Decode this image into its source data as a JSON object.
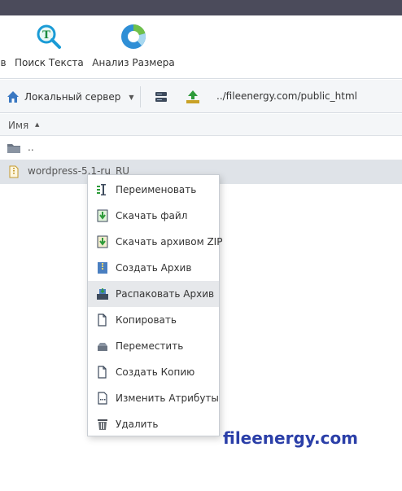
{
  "toolbar": {
    "partial_label": "в",
    "search_text_label": "Поиск Текста",
    "size_analysis_label": "Анализ Размера"
  },
  "pathbar": {
    "server_label": "Локальный сервер",
    "path": "../fileenergy.com/public_html"
  },
  "file_list": {
    "column_name": "Имя",
    "parent_dir": "..",
    "selected_file": "wordpress-5.1-ru_RU"
  },
  "context_menu": {
    "items": [
      {
        "label": "Переименовать",
        "icon": "rename-icon"
      },
      {
        "label": "Скачать файл",
        "icon": "download-file-icon"
      },
      {
        "label": "Скачать архивом ZIP",
        "icon": "download-zip-icon"
      },
      {
        "label": "Создать Архив",
        "icon": "create-archive-icon"
      },
      {
        "label": "Распаковать Архив",
        "icon": "extract-archive-icon",
        "highlighted": true
      },
      {
        "label": "Копировать",
        "icon": "copy-icon"
      },
      {
        "label": "Переместить",
        "icon": "move-icon"
      },
      {
        "label": "Создать Копию",
        "icon": "duplicate-icon"
      },
      {
        "label": "Изменить Атрибуты",
        "icon": "attributes-icon"
      },
      {
        "label": "Удалить",
        "icon": "trash-icon"
      }
    ]
  },
  "watermark": "fileenergy.com",
  "colors": {
    "topbar": "#4b4b5b",
    "selected_row": "#dfe3e8",
    "menu_hover": "#e6e8eb",
    "watermark": "#2b3fa8"
  }
}
